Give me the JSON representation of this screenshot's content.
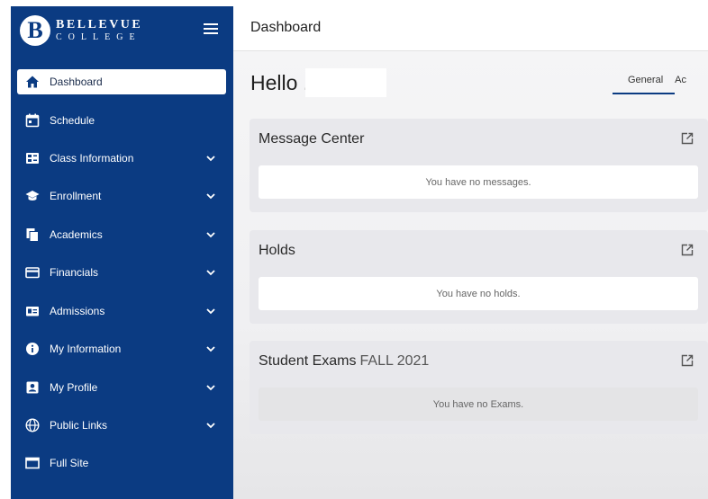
{
  "brand": {
    "logo_letter": "B",
    "line1": "BELLEVUE",
    "line2": "COLLEGE"
  },
  "sidebar": {
    "items": [
      {
        "label": "Dashboard",
        "icon": "home-icon",
        "active": true,
        "expandable": false
      },
      {
        "label": "Schedule",
        "icon": "calendar-icon",
        "expandable": false
      },
      {
        "label": "Class Information",
        "icon": "class-info-icon",
        "expandable": true
      },
      {
        "label": "Enrollment",
        "icon": "graduation-cap-icon",
        "expandable": true
      },
      {
        "label": "Academics",
        "icon": "documents-icon",
        "expandable": true
      },
      {
        "label": "Financials",
        "icon": "credit-card-icon",
        "expandable": true
      },
      {
        "label": "Admissions",
        "icon": "id-card-icon",
        "expandable": true
      },
      {
        "label": "My Information",
        "icon": "info-icon",
        "expandable": true
      },
      {
        "label": "My Profile",
        "icon": "profile-icon",
        "expandable": true
      },
      {
        "label": "Public Links",
        "icon": "globe-icon",
        "expandable": true
      },
      {
        "label": "Full Site",
        "icon": "window-icon",
        "expandable": false
      }
    ]
  },
  "topbar": {
    "title": "Dashboard"
  },
  "main": {
    "greeting": "Hello .",
    "tabs": [
      {
        "label": "General",
        "active": true
      },
      {
        "label": "Ac",
        "active": false
      }
    ]
  },
  "cards": {
    "messages": {
      "title": "Message Center",
      "body": "You have no messages."
    },
    "holds": {
      "title": "Holds",
      "body": "You have no holds."
    },
    "exams": {
      "title": "Student Exams",
      "term": "FALL 2021",
      "body": "You have no Exams."
    }
  },
  "colors": {
    "sidebar_bg": "#0b3b82",
    "accent": "#0b3b82"
  }
}
